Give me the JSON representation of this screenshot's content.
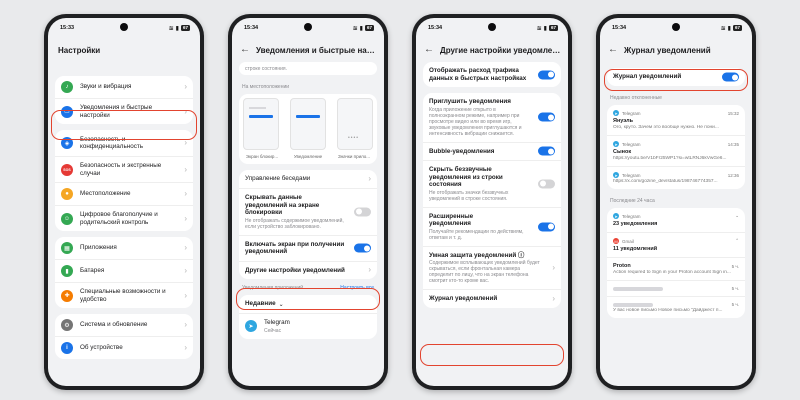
{
  "screen1": {
    "status": {
      "time": "15:33",
      "battery": "67"
    },
    "title": "Настройки",
    "groups": [
      [
        {
          "label": "Звуки и вибрация",
          "color": "#34a853",
          "glyph": "♪"
        },
        {
          "label": "Уведомления и быстрые настройки",
          "color": "#1a73e8",
          "glyph": "▭"
        }
      ],
      [
        {
          "label": "Безопасность и конфиденциальность",
          "color": "#1a73e8",
          "glyph": "◈"
        },
        {
          "label": "Безопасность и экстренные случаи",
          "color": "#e53935",
          "glyph": "SOS"
        },
        {
          "label": "Местоположение",
          "color": "#f5a623",
          "glyph": "●"
        },
        {
          "label": "Цифровое благополучие и родительский контроль",
          "color": "#34a853",
          "glyph": "☺"
        }
      ],
      [
        {
          "label": "Приложения",
          "color": "#34a853",
          "glyph": "▦"
        },
        {
          "label": "Батарея",
          "color": "#34a853",
          "glyph": "▮"
        },
        {
          "label": "Специальные возможности и удобство",
          "color": "#f57c00",
          "glyph": "✚"
        }
      ],
      [
        {
          "label": "Система и обновление",
          "color": "#757575",
          "glyph": "⚙"
        },
        {
          "label": "Об устройстве",
          "color": "#1a73e8",
          "glyph": "i"
        }
      ]
    ]
  },
  "screen2": {
    "status": {
      "time": "15:34",
      "battery": "67"
    },
    "title": "Уведомления и быстрые настройки",
    "top_fragment": "строке состояния.",
    "lockscreen_section": "На местоположении",
    "mockups": [
      "Экран блокир...",
      "Уведомление",
      "Значки прило..."
    ],
    "conversations": "Управление беседами",
    "hide_data": {
      "label": "Скрывать данные уведомлений на экране блокировки",
      "sub": "Не отображать содержимое уведомлений, если устройство заблокировано."
    },
    "wake_screen": "Включать экран при получении уведомлений",
    "other_settings": "Другие настройки уведомлений",
    "apps_section": "Уведомления приложений",
    "apps_link": "Настроить все",
    "recent": "Недавние",
    "app_name": "Telegram",
    "app_sub": "Сейчас"
  },
  "screen3": {
    "status": {
      "time": "15:34",
      "battery": "67"
    },
    "title": "Другие настройки уведомлений",
    "traffic": "Отображать расход трафика данных в быстрых настройках",
    "mute": {
      "label": "Приглушить уведомления",
      "sub": "Когда приложение открыто в полноэкранном режиме, например при просмотре видео или во время игр, звуковые уведомления приглушаются и интенсивность вибрации снижается."
    },
    "bubble": "Bubble-уведомления",
    "hide_silent": {
      "label": "Скрыть беззвучные уведомления из строки состояния",
      "sub": "Не отображать значки беззвучных уведомлений в строке состояния."
    },
    "extended": {
      "label": "Расширенные уведомления",
      "sub": "Получайте рекомендации по действиям, ответам и т. д."
    },
    "smart": {
      "label": "Умная защита уведомлений",
      "info_icon": "ⓘ",
      "sub": "Содержимое всплывающих уведомлений будет скрываться, если фронтальная камера определит по лицу, что на экран телефона смотрит кто-то кроме вас."
    },
    "journal": "Журнал уведомлений"
  },
  "screen4": {
    "status": {
      "time": "15:34",
      "battery": "67"
    },
    "title": "Журнал уведомлений",
    "toggle_label": "Журнал уведомлений",
    "recently_dismissed": "Недавно отклоненные",
    "items": [
      {
        "app": "Telegram",
        "time": "15:32",
        "title": "Януэль",
        "text": "Ого, круто. Зачем это вообще нужно. Не пони..."
      },
      {
        "app": "Telegram",
        "time": "14:35",
        "title": "Сынок",
        "text": "https://youtu.be/V1bFr25WP1?si=wtLRNJ6kVwGe6..."
      },
      {
        "app": "Telegram",
        "time": "12:36",
        "title": "",
        "text": "https://x.com/gozine_dev/status/198746774357..."
      }
    ],
    "last24": "Последние 24 часа",
    "groups": [
      {
        "app": "Telegram",
        "count": "23 уведомления"
      },
      {
        "app": "Gmail",
        "count": "11 уведомлений"
      }
    ],
    "proton": {
      "title": "Proton",
      "time": "5 ч.",
      "text": "Action required to Sign in your Proton account Sign in..."
    },
    "more1": {
      "time": "5 ч."
    },
    "more2": {
      "time": "5 ч.",
      "text": "У вас новое письмо Новое письмо \"Дайджест п..."
    }
  }
}
